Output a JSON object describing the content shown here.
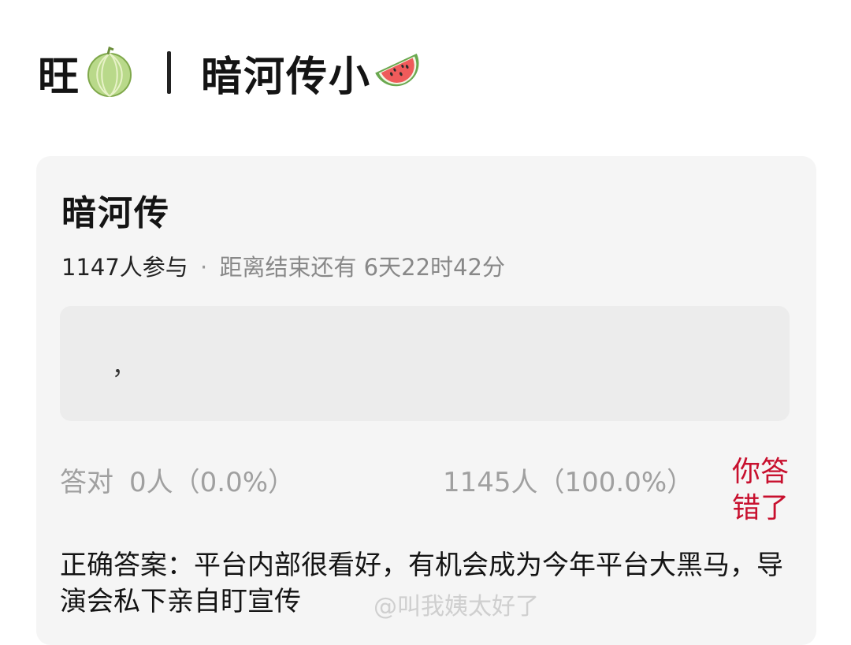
{
  "header": {
    "left_text": "旺",
    "left_icon": "melon-icon",
    "right_text": "暗河传小",
    "right_icon": "watermelon-icon"
  },
  "card": {
    "title": "暗河传",
    "participants": "1147人参与",
    "separator": "·",
    "remaining": "距离结束还有 6天22时42分",
    "option_text": "，",
    "correct_label": "答对",
    "correct_stats": "0人（0.0%）",
    "wrong_stats": "1145人（100.0%）",
    "verdict": "你答错了",
    "answer": "正确答案：平台内部很看好，有机会成为今年平台大黑马，导演会私下亲自盯宣传"
  },
  "watermark": "@叫我姨太好了",
  "colors": {
    "verdict": "#c8102e",
    "card_bg": "#f5f5f5",
    "option_bg": "#ececec",
    "muted_text": "#a0a0a0"
  }
}
